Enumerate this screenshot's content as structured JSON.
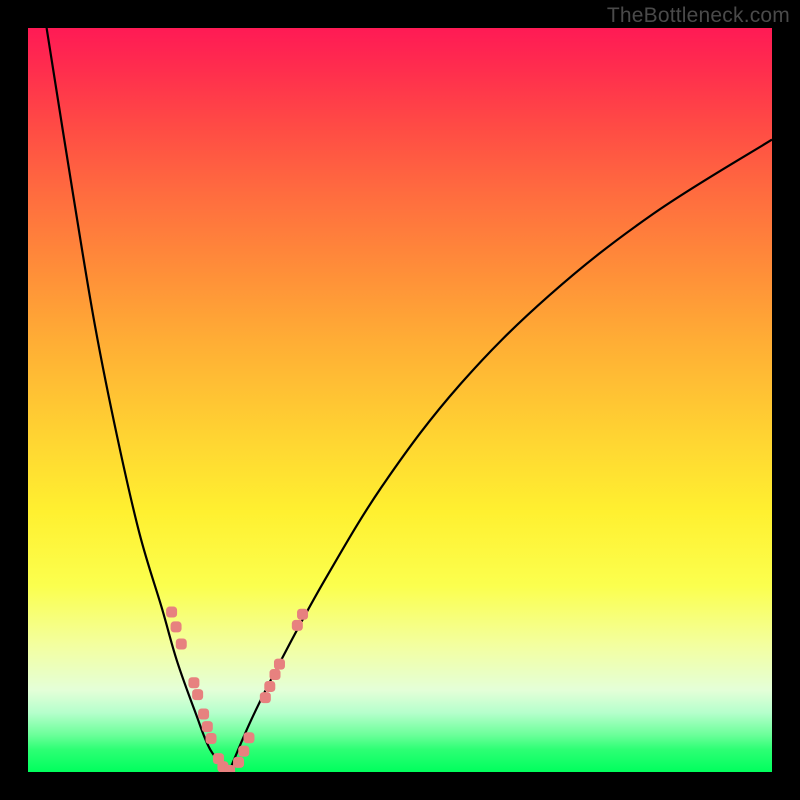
{
  "watermark": "TheBottleneck.com",
  "colors": {
    "frame": "#000000",
    "curve": "#000000",
    "marker": "#e7817f",
    "gradient_top": "#ff1a55",
    "gradient_bottom": "#00ff5d"
  },
  "chart_data": {
    "type": "line",
    "title": "",
    "xlabel": "",
    "ylabel": "",
    "xlim": [
      0,
      100
    ],
    "ylim": [
      0,
      100
    ],
    "axes_visible": false,
    "grid": false,
    "legend": false,
    "note": "Values are relative 0–100 screen-space estimates; the image has no numeric tick labels.",
    "series": [
      {
        "name": "left_curve",
        "x": [
          2.5,
          6,
          9,
          12,
          15,
          18,
          20,
          22.5,
          24.5,
          27
        ],
        "y": [
          100,
          78,
          60,
          45,
          32,
          22,
          15,
          8,
          3,
          0
        ]
      },
      {
        "name": "right_curve",
        "x": [
          27,
          30,
          34,
          40,
          48,
          58,
          70,
          84,
          100
        ],
        "y": [
          0,
          7,
          15,
          26,
          39,
          52,
          64,
          75,
          85
        ]
      }
    ],
    "markers": {
      "name": "highlighted_points",
      "shape": "rounded-square",
      "size": 11,
      "points": [
        {
          "x": 19.3,
          "y": 21.5
        },
        {
          "x": 19.9,
          "y": 19.5
        },
        {
          "x": 20.6,
          "y": 17.2
        },
        {
          "x": 22.3,
          "y": 12.0
        },
        {
          "x": 22.8,
          "y": 10.4
        },
        {
          "x": 23.6,
          "y": 7.8
        },
        {
          "x": 24.1,
          "y": 6.1
        },
        {
          "x": 24.6,
          "y": 4.5
        },
        {
          "x": 25.6,
          "y": 1.8
        },
        {
          "x": 26.2,
          "y": 0.7
        },
        {
          "x": 27.1,
          "y": 0.2
        },
        {
          "x": 28.3,
          "y": 1.3
        },
        {
          "x": 29.0,
          "y": 2.8
        },
        {
          "x": 29.7,
          "y": 4.6
        },
        {
          "x": 31.9,
          "y": 10.0
        },
        {
          "x": 32.5,
          "y": 11.5
        },
        {
          "x": 33.2,
          "y": 13.1
        },
        {
          "x": 33.8,
          "y": 14.5
        },
        {
          "x": 36.2,
          "y": 19.7
        },
        {
          "x": 36.9,
          "y": 21.2
        }
      ]
    }
  }
}
